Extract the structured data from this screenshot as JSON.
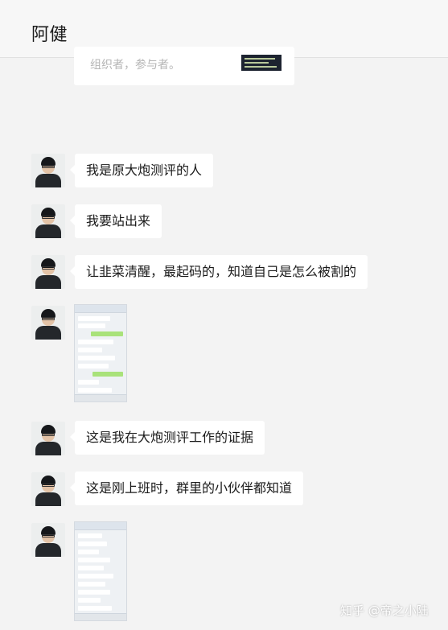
{
  "header": {
    "contact_name": "阿健"
  },
  "previous_message": {
    "text": "组织者，参与者。"
  },
  "messages": [
    {
      "type": "text",
      "text": "我是原大炮测评的人"
    },
    {
      "type": "text",
      "text": "我要站出来"
    },
    {
      "type": "text",
      "text": "让韭菜清醒，最起码的，知道自己是怎么被割的"
    },
    {
      "type": "image",
      "icon": "chat-screenshot"
    },
    {
      "type": "text",
      "text": "这是我在大炮测评工作的证据"
    },
    {
      "type": "text",
      "text": "这是刚上班时，群里的小伙伴都知道"
    },
    {
      "type": "image",
      "icon": "chat-screenshot"
    }
  ],
  "watermark": {
    "text": "知乎 @帝之小陆"
  },
  "colors": {
    "background": "#f3f3f3",
    "bubble": "#ffffff",
    "text": "#1a1a1a"
  }
}
